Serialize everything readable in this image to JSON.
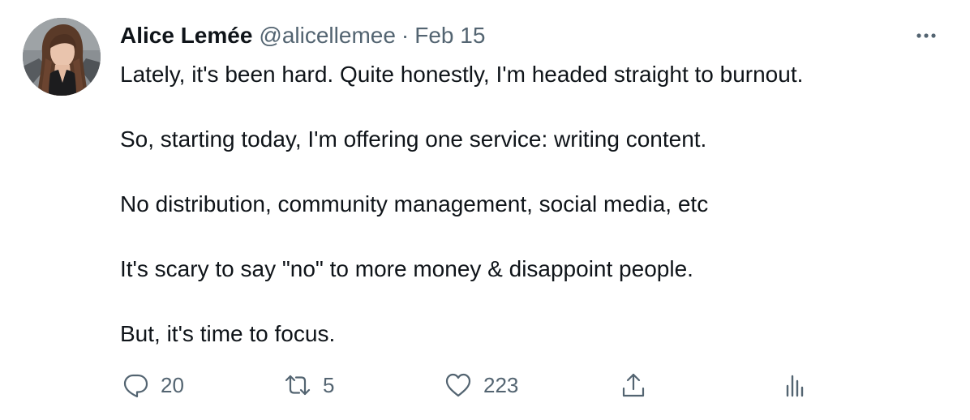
{
  "tweet": {
    "author": {
      "display_name": "Alice Lemée",
      "handle": "@alicellemee",
      "avatar_icon": "profile-photo"
    },
    "separator": "·",
    "timestamp": "Feb 15",
    "more_icon": "more-horizontal-icon",
    "paragraphs": [
      "Lately, it's been hard. Quite honestly, I'm headed straight to burnout.",
      "So, starting today, I'm offering one service: writing content.",
      "No distribution, community management, social media, etc",
      "It's scary to say \"no\" to more money & disappoint people.",
      "But, it's time to focus."
    ],
    "actions": {
      "reply": {
        "icon": "reply-icon",
        "count": "20"
      },
      "retweet": {
        "icon": "retweet-icon",
        "count": "5"
      },
      "like": {
        "icon": "heart-icon",
        "count": "223"
      },
      "share": {
        "icon": "share-icon"
      },
      "analytics": {
        "icon": "analytics-icon"
      }
    }
  },
  "colors": {
    "text": "#0f1419",
    "secondary": "#536471",
    "background": "#ffffff"
  }
}
